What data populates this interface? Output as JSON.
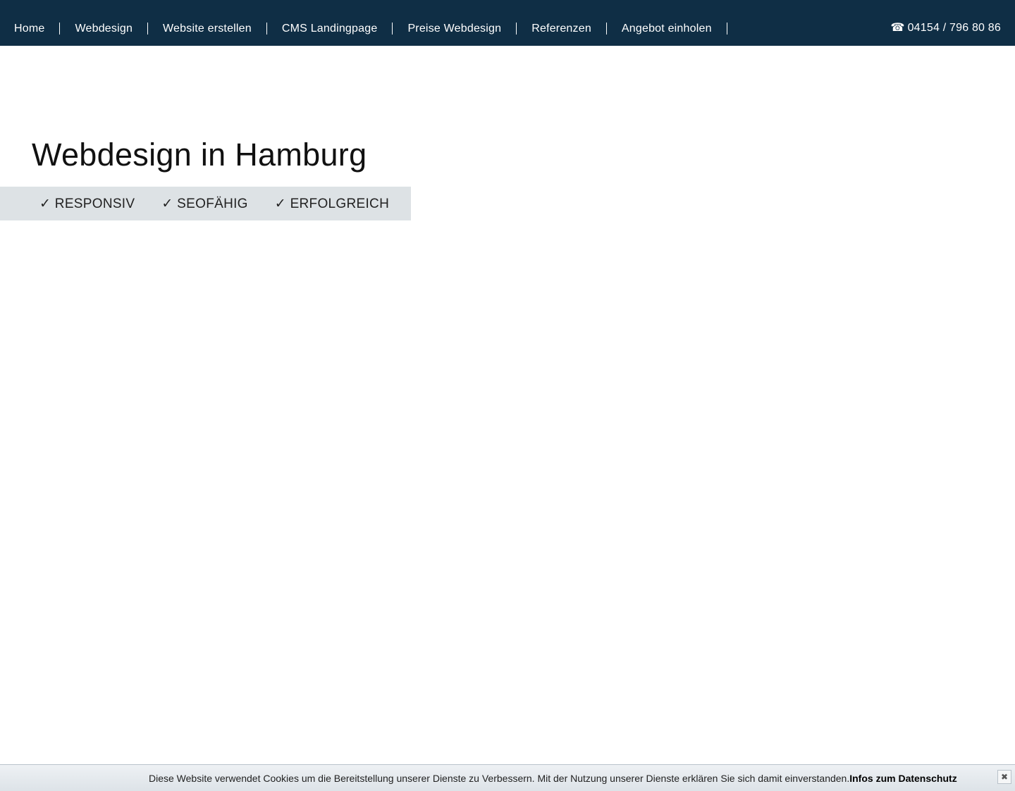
{
  "nav": {
    "items": [
      {
        "label": "Home"
      },
      {
        "label": "Webdesign"
      },
      {
        "label": "Website erstellen"
      },
      {
        "label": "CMS Landingpage"
      },
      {
        "label": "Preise Webdesign"
      },
      {
        "label": "Referenzen"
      },
      {
        "label": "Angebot einholen"
      }
    ],
    "phone_icon": "☎",
    "phone": "04154 / 796 80 86"
  },
  "hero": {
    "title": "Webdesign in Hamburg",
    "features": [
      "✓ RESPONSIV",
      "✓ SEOFÄHIG",
      "✓ ERFOLGREICH"
    ]
  },
  "cookie": {
    "text": "Diese Website verwendet Cookies um die Bereitstellung unserer Dienste zu Verbessern. Mit der Nutzung unserer Dienste erklären Sie sich damit einverstanden.",
    "link_label": "Infos zum Datenschutz",
    "close_label": "✖"
  },
  "colors": {
    "header_bg": "#0f2e45",
    "feature_bar_bg": "#dde2e5"
  }
}
